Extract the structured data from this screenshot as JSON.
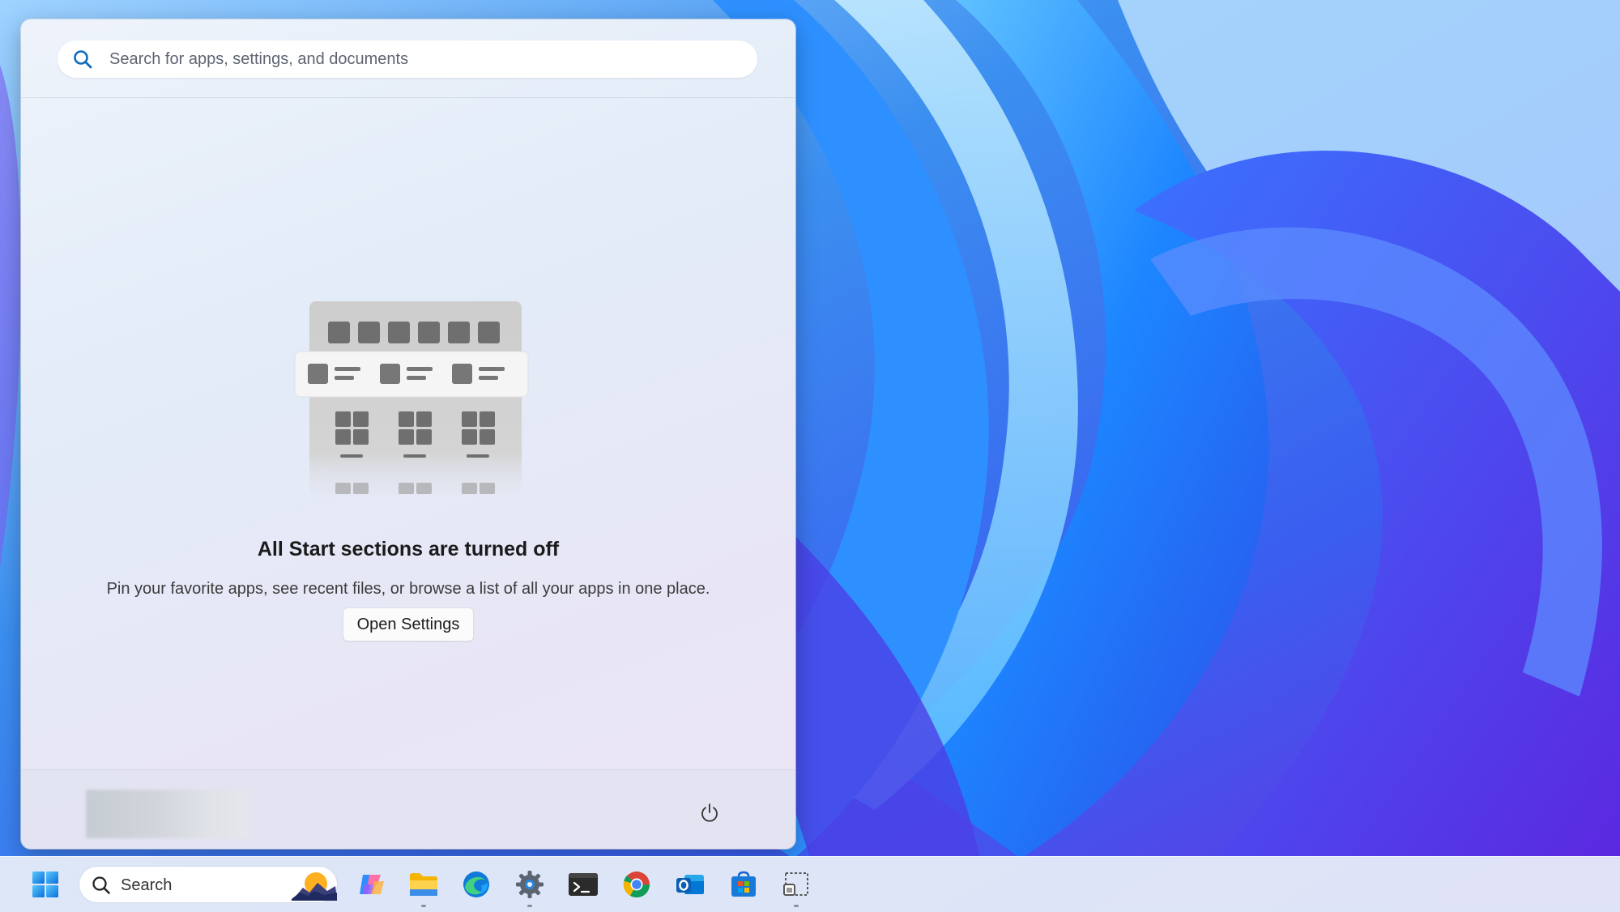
{
  "start_menu": {
    "search_placeholder": "Search for apps, settings, and documents",
    "empty_title": "All Start sections are turned off",
    "empty_description": "Pin your favorite apps, see recent files, or browse a list of all your apps in one place.",
    "open_settings_label": "Open Settings"
  },
  "taskbar": {
    "search_label": "Search",
    "icons": [
      "start-icon",
      "weather-icon",
      "copilot-icon",
      "file-explorer-icon",
      "edge-icon",
      "settings-icon",
      "terminal-icon",
      "chrome-icon",
      "outlook-icon",
      "microsoft-store-icon",
      "snipping-tool-icon"
    ]
  },
  "colors": {
    "accent": "#0078d4",
    "wallpaper_blue": "#1f6fe8",
    "wallpaper_purple": "#5a2fd6"
  }
}
